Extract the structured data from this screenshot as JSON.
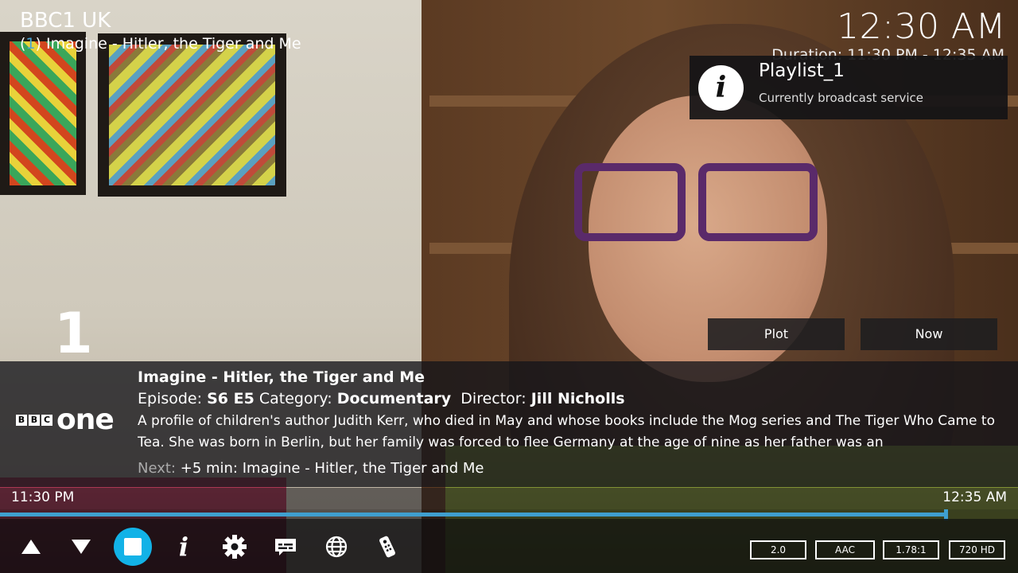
{
  "header": {
    "channel": "BBC1 UK",
    "now_number": "1",
    "now_title": "Imagine - Hitler, the Tiger and Me",
    "clock": "12:30 AM",
    "duration": "Duration: 11:30 PM - 12:35 AM"
  },
  "notification": {
    "icon": "info-icon",
    "title": "Playlist_1",
    "message": "Currently broadcast service"
  },
  "channel_number": "1",
  "buttons": {
    "plot": "Plot",
    "now": "Now"
  },
  "info": {
    "logo_blocks": [
      "B",
      "B",
      "C"
    ],
    "logo_word": "one",
    "title": "Imagine - Hitler, the Tiger and Me",
    "episode_label": "Episode:",
    "episode": "S6 E5",
    "category_label": "Category:",
    "category": "Documentary",
    "director_label": "Director:",
    "director": "Jill Nicholls",
    "plot": "A profile of children's author Judith Kerr, who died in May and whose books include the Mog series and The Tiger Who Came to Tea. She was born in Berlin, but her family was forced to flee Germany at the age of nine as her father was an",
    "next_label": "Next:",
    "next_text": "+5 min: Imagine - Hitler, the Tiger and Me"
  },
  "progress": {
    "start": "11:30 PM",
    "end": "12:35 AM",
    "fraction": 0.927,
    "color": "#3f9fcf"
  },
  "controls": {
    "icons": [
      "chevron-up-icon",
      "chevron-down-icon",
      "stop-icon",
      "info-icon",
      "gear-icon",
      "subtitles-icon",
      "globe-icon",
      "remote-icon"
    ],
    "accent": "#12b2e7",
    "badges": [
      "2.0",
      "AAC",
      "1.78:1",
      "720 HD"
    ]
  }
}
